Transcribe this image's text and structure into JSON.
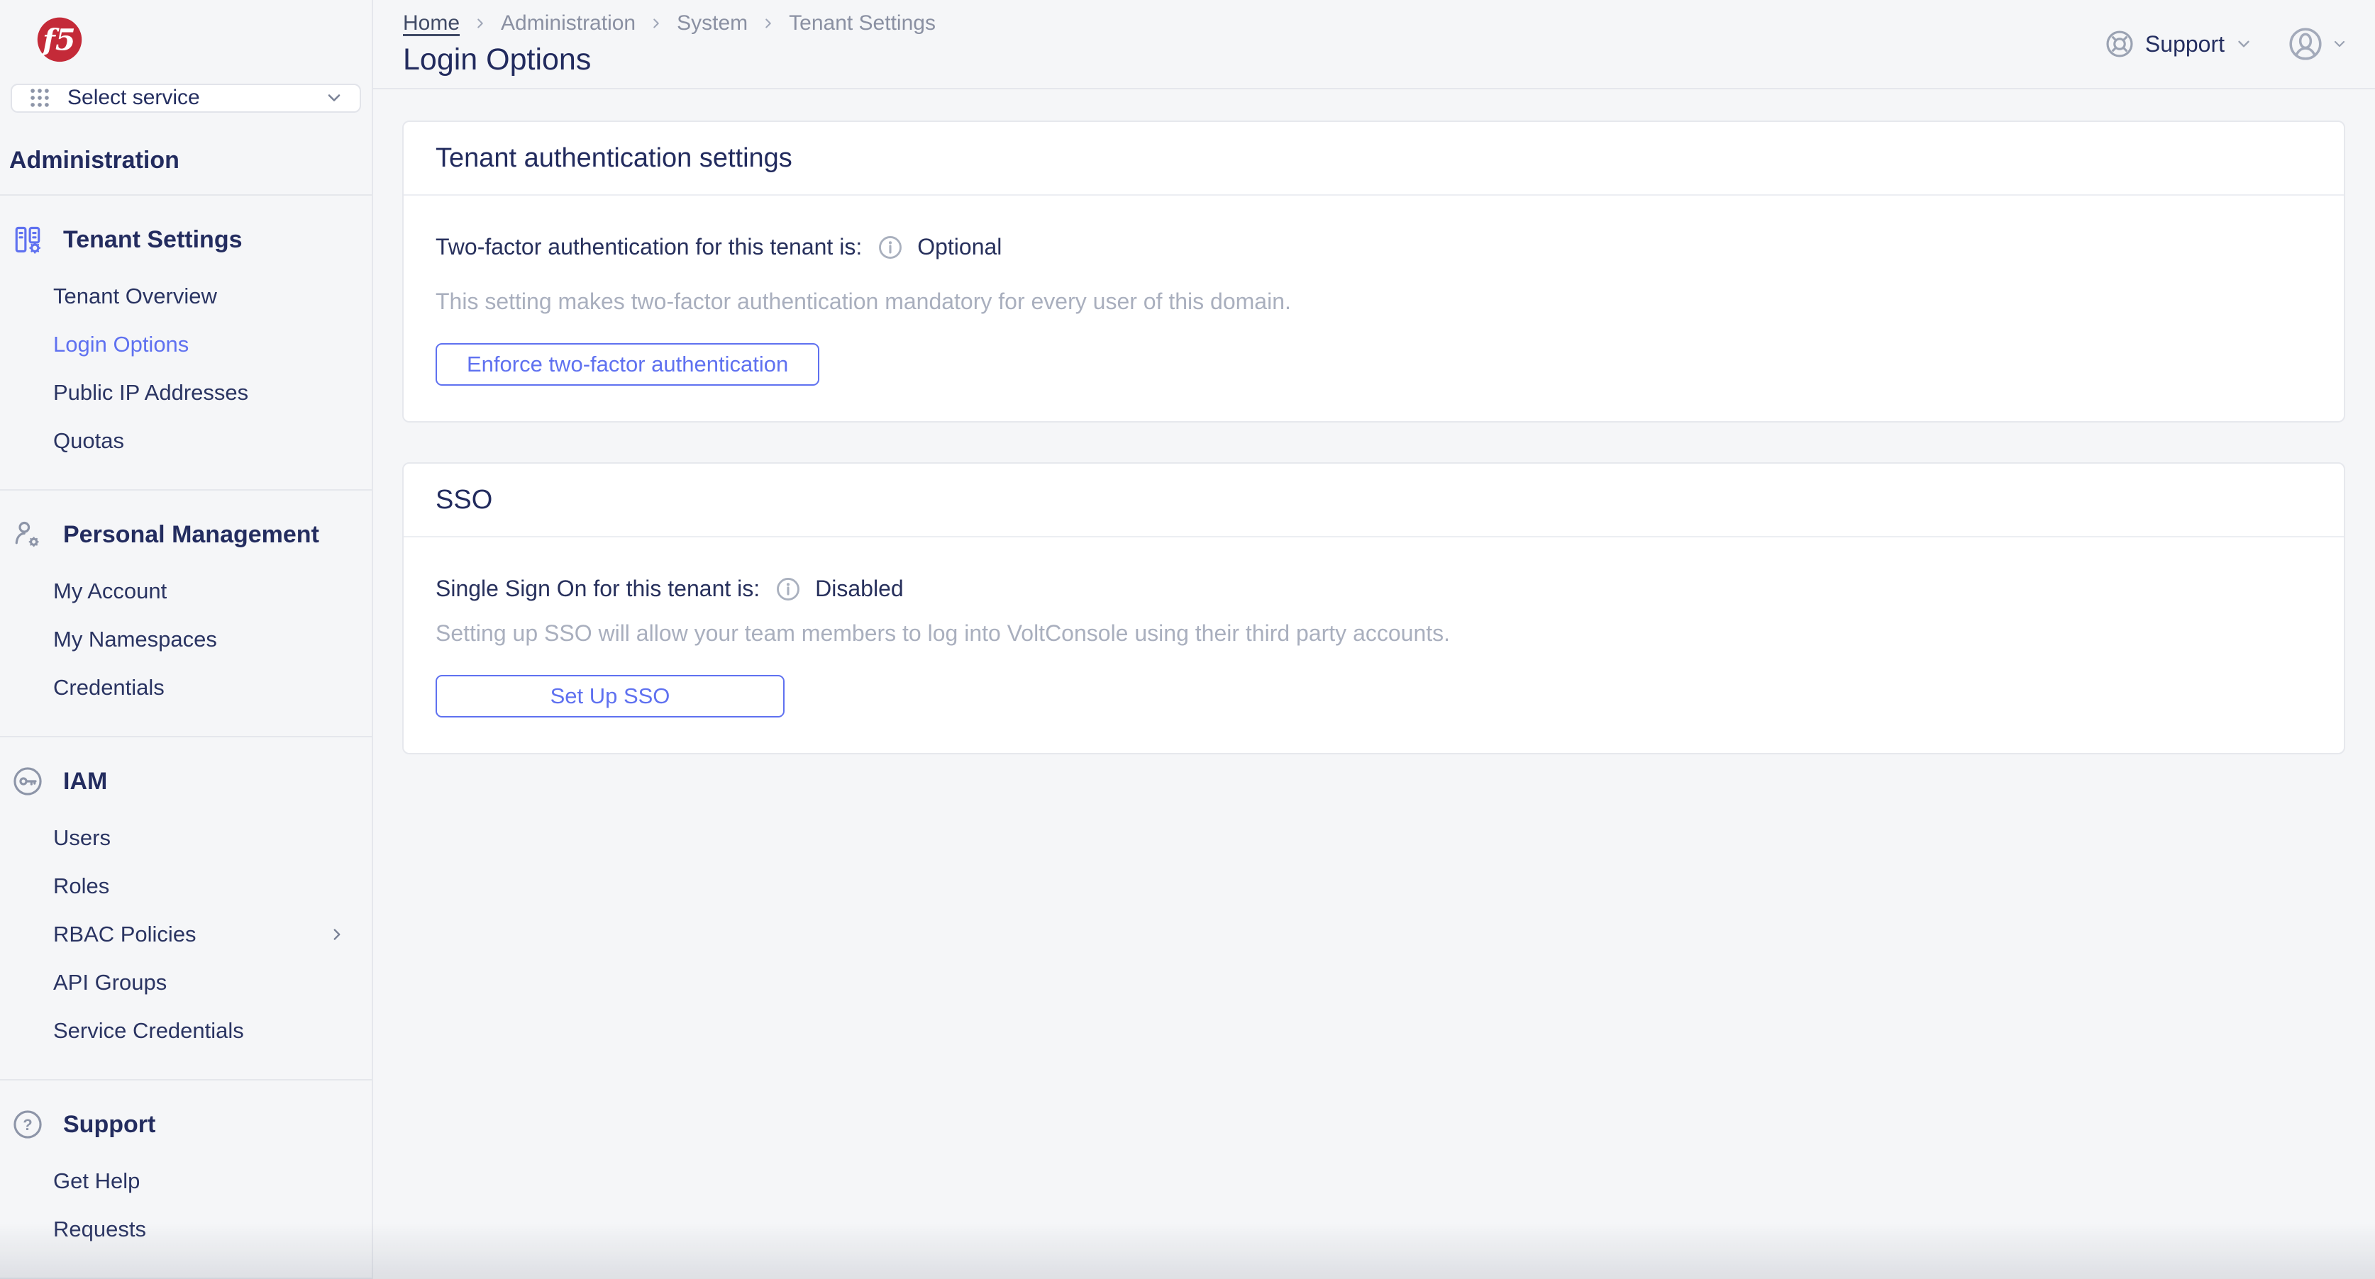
{
  "brand": {
    "logo_text": "f5",
    "logo_color": "#C42A38"
  },
  "service_selector": {
    "label": "Select service"
  },
  "sidebar": {
    "heading": "Administration",
    "sections": [
      {
        "title": "Tenant Settings",
        "items": [
          {
            "label": "Tenant Overview"
          },
          {
            "label": "Login Options",
            "active": true
          },
          {
            "label": "Public IP Addresses"
          },
          {
            "label": "Quotas"
          }
        ]
      },
      {
        "title": "Personal Management",
        "items": [
          {
            "label": "My Account"
          },
          {
            "label": "My Namespaces"
          },
          {
            "label": "Credentials"
          }
        ]
      },
      {
        "title": "IAM",
        "items": [
          {
            "label": "Users"
          },
          {
            "label": "Roles"
          },
          {
            "label": "RBAC Policies",
            "has_submenu": true
          },
          {
            "label": "API Groups"
          },
          {
            "label": "Service Credentials"
          }
        ]
      },
      {
        "title": "Support",
        "items": [
          {
            "label": "Get Help"
          },
          {
            "label": "Requests"
          }
        ]
      }
    ]
  },
  "header": {
    "breadcrumb": [
      "Home",
      "Administration",
      "System",
      "Tenant Settings"
    ],
    "page_title": "Login Options",
    "support_label": "Support"
  },
  "cards": [
    {
      "title": "Tenant authentication settings",
      "status_label": "Two-factor authentication for this tenant is:",
      "status_value": "Optional",
      "description": "This setting makes two-factor authentication mandatory for every user of this domain.",
      "button_label": "Enforce two-factor authentication"
    },
    {
      "title": "SSO",
      "status_label": "Single Sign On for this tenant is:",
      "status_value": "Disabled",
      "description": "Setting up SSO will allow your team members to log into VoltConsole using their third party accounts.",
      "button_label": "Set Up SSO"
    }
  ],
  "colors": {
    "accent": "#5F71F0",
    "navy": "#232C5F",
    "muted_text": "#A9AFBE",
    "breadcrumb_gray": "#8A90A2",
    "border": "#E5E7EC",
    "background": "#F5F6F8",
    "logo_red": "#C42A38"
  }
}
